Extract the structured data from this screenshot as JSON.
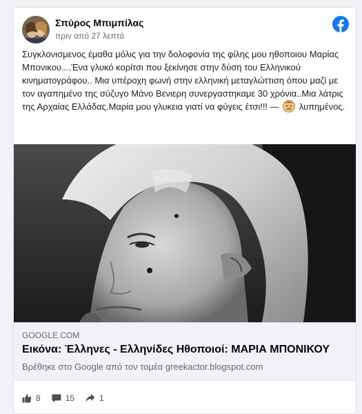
{
  "post": {
    "author": "Σπύρος Μπιμπίλας",
    "timestamp": "πριν από 27 λεπτά",
    "text": "Συγκλονισμενος έμαθα μόλις για την δολοφονία της φίλης μου ηθοποιου Μαρίας Μπονικου....Ένα γλυκό κορίτσι που ξεκίνησε στην δύση του Ελληνικού κινηματογράφου.. Μια υπέροχη φωνή στην ελληνική μεταγλώττιση όπου μαζί με τον αγαπημένο της σύζυγο Μάνο Βενιερη συνεργαστηκαμε 30 χρόνια..Μια λάτρις της Αρχαίας Ελλάδας.Μαρία μου γλυκεια γιατί να φύγεις έτσι!!! — ",
    "feeling": "λυπημένος."
  },
  "link": {
    "domain": "GOOGLE.COM",
    "title": "Εικόνα: Έλληνες - Ελληνίδες Ηθοποιοί: ΜΑΡΙΑ ΜΠΟΝΙΚΟΥ",
    "description": "Βρέθηκε στο Google από τον τομέα greekactor.blogspot.com"
  },
  "stats": {
    "likes": "8",
    "comments": "15",
    "shares": "1"
  },
  "icons": {
    "brand": "facebook-logo-icon",
    "feeling": "sad-face-emoji-icon",
    "like": "thumbs-up-icon",
    "comment": "comment-icon",
    "share": "share-icon"
  },
  "colors": {
    "facebook_blue": "#1877f2",
    "stat_gray": "#4b4f56"
  }
}
